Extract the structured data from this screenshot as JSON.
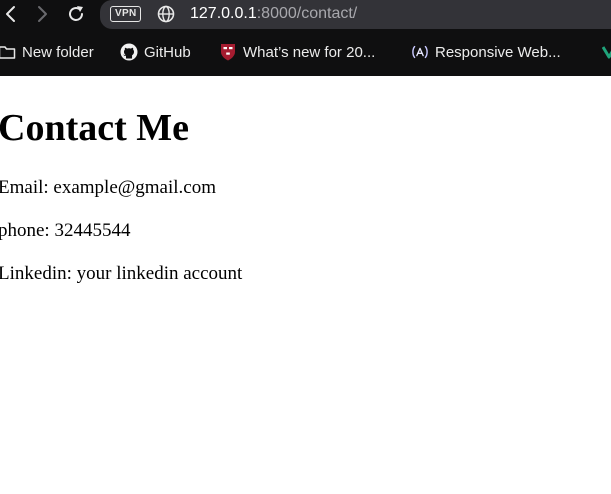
{
  "browser": {
    "vpn_label": "VPN",
    "url_host": "127.0.0.1",
    "url_rest": ":8000/contact/"
  },
  "bookmarks": [
    {
      "label": "New folder",
      "icon": "folder-icon"
    },
    {
      "label": "GitHub",
      "icon": "github-icon"
    },
    {
      "label": "What’s new for 20...",
      "icon": "harvard-shield-icon"
    },
    {
      "label": "Responsive Web...",
      "icon": "freecodecamp-icon"
    },
    {
      "label": "",
      "icon": "green-v-icon"
    }
  ],
  "page": {
    "title": "Contact Me",
    "email": "Email: example@gmail.com",
    "phone": "phone: 32445544",
    "linkedin": "Linkedin: your linkedin account"
  },
  "colors": {
    "toolbar_bg": "#0f0f10",
    "addressbar_bg": "#333338",
    "url_host": "#ffffff",
    "url_rest": "#a8a8ad",
    "harvard_red": "#a51c30",
    "green_accent": "#1fa37a"
  }
}
